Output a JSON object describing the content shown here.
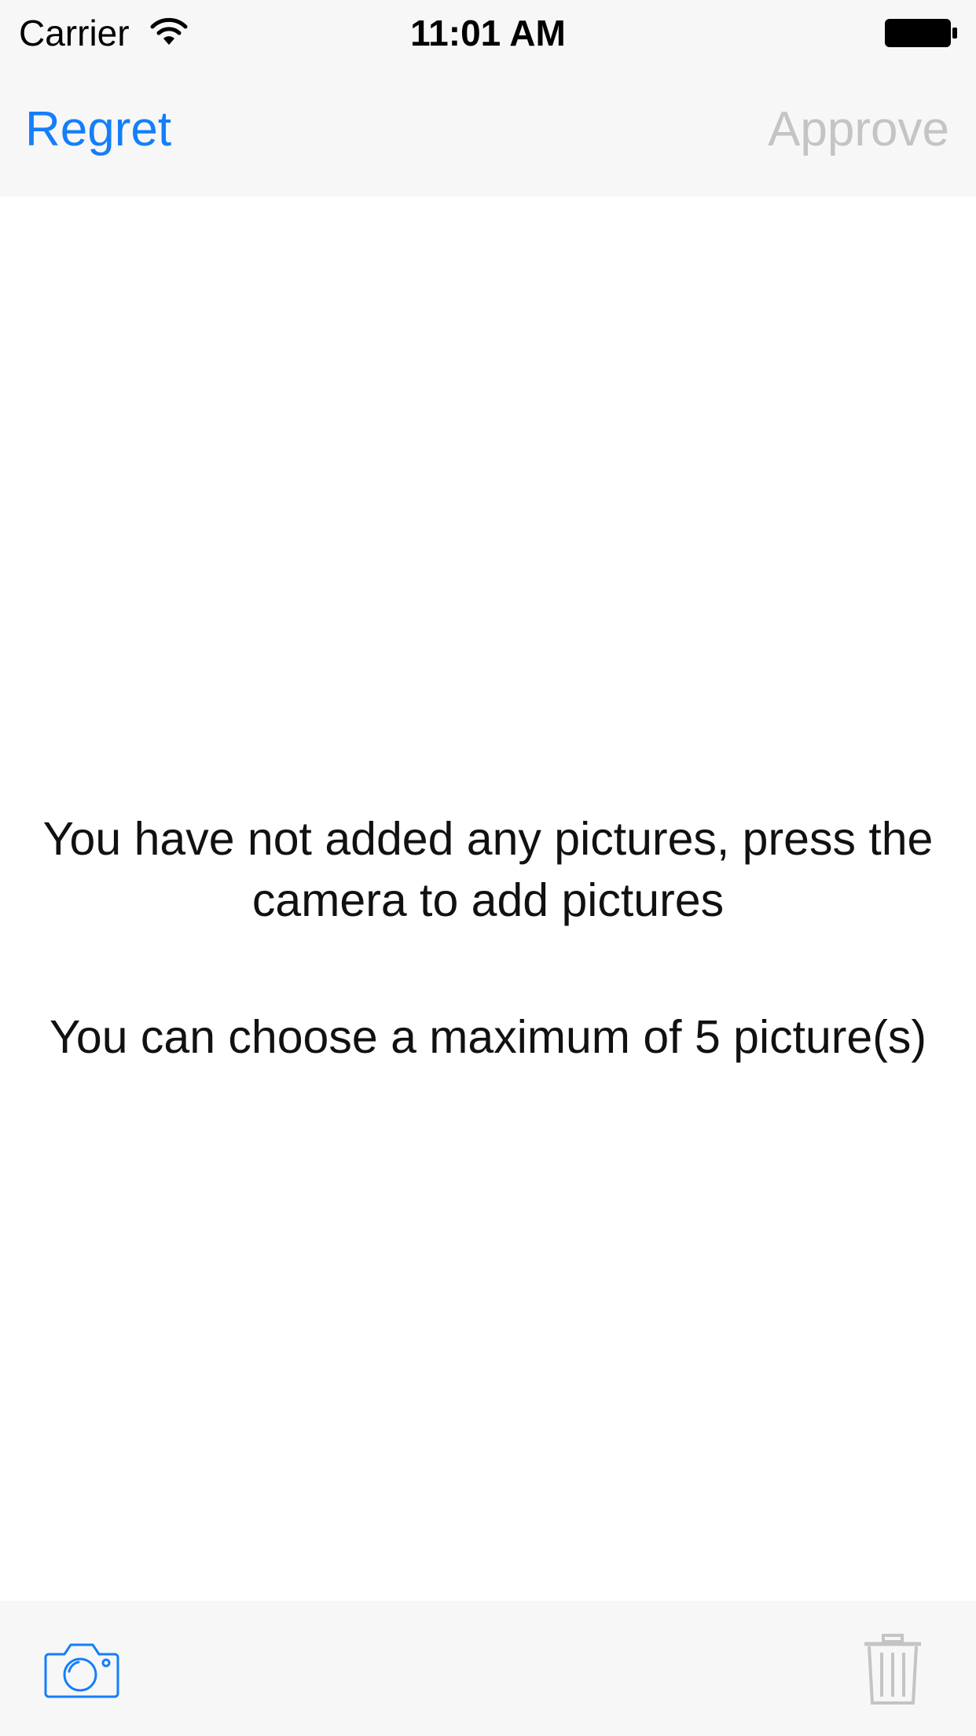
{
  "status_bar": {
    "carrier": "Carrier",
    "time": "11:01 AM",
    "icons": [
      "wifi-icon",
      "battery-icon"
    ]
  },
  "nav_bar": {
    "left_label": "Regret",
    "right_label": "Approve",
    "right_enabled": false,
    "accent_color": "#147efb",
    "disabled_color": "#c4c4c4"
  },
  "content": {
    "empty_message": "You have not added any pictures, press the camera to add pictures",
    "limit_message": "You can choose a maximum of 5 picture(s)"
  },
  "toolbar": {
    "items": [
      {
        "icon": "camera-icon",
        "enabled": true
      },
      {
        "icon": "trash-icon",
        "enabled": false
      }
    ]
  }
}
